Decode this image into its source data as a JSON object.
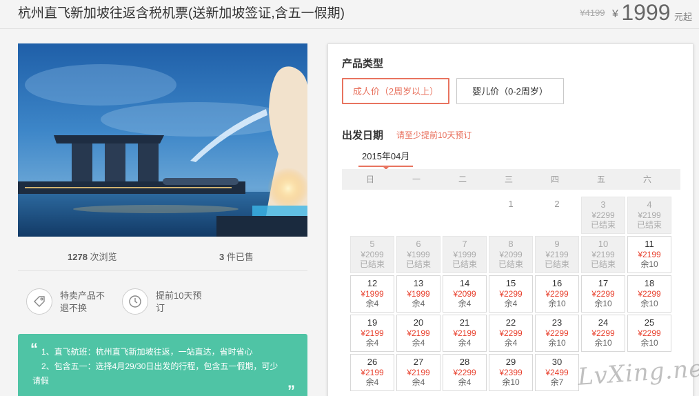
{
  "header": {
    "title": "杭州直飞新加坡往返含税机票(送新加坡签证,含五一假期)",
    "old_price": "¥4199",
    "currency": "¥",
    "price": "1999",
    "price_suffix": "元起"
  },
  "stats": {
    "views_count": "1278",
    "views_label": "次浏览",
    "sold_count": "3",
    "sold_label": "件已售"
  },
  "features": [
    {
      "icon": "tag-icon",
      "text": "特卖产品不退不换"
    },
    {
      "icon": "clock-icon",
      "text": "提前10天预订"
    }
  ],
  "notes": {
    "open_quote": "“",
    "close_quote": "”",
    "line1": "1、直飞航班：杭州直飞新加坡往返，一站直达，省时省心",
    "line2": "2、包含五一：选择4月29/30日出发的行程，包含五一假期，可少",
    "line3": "请假"
  },
  "panel": {
    "product_type_title": "产品类型",
    "adult_label": "成人价（2周岁以上）",
    "infant_label": "婴儿价（0-2周岁）",
    "departure_title": "出发日期",
    "departure_hint": "请至少提前10天预订",
    "month": "2015年04月",
    "weekdays": [
      "日",
      "一",
      "二",
      "三",
      "四",
      "五",
      "六"
    ]
  },
  "calendar": {
    "ended_label": "已结束",
    "days": [
      {
        "day": "1",
        "col": 3,
        "row": 0,
        "state": "plain"
      },
      {
        "day": "2",
        "col": 4,
        "row": 0,
        "state": "plain"
      },
      {
        "day": "3",
        "col": 5,
        "row": 0,
        "state": "ended",
        "price": "¥2299"
      },
      {
        "day": "4",
        "col": 6,
        "row": 0,
        "state": "ended",
        "price": "¥2199"
      },
      {
        "day": "5",
        "col": 0,
        "row": 1,
        "state": "ended",
        "price": "¥2099"
      },
      {
        "day": "6",
        "col": 1,
        "row": 1,
        "state": "ended",
        "price": "¥1999"
      },
      {
        "day": "7",
        "col": 2,
        "row": 1,
        "state": "ended",
        "price": "¥1999"
      },
      {
        "day": "8",
        "col": 3,
        "row": 1,
        "state": "ended",
        "price": "¥2099"
      },
      {
        "day": "9",
        "col": 4,
        "row": 1,
        "state": "ended",
        "price": "¥2199"
      },
      {
        "day": "10",
        "col": 5,
        "row": 1,
        "state": "ended",
        "price": "¥2199"
      },
      {
        "day": "11",
        "col": 6,
        "row": 1,
        "state": "open",
        "price": "¥2199",
        "stock": "余10"
      },
      {
        "day": "12",
        "col": 0,
        "row": 2,
        "state": "open",
        "price": "¥1999",
        "stock": "余4"
      },
      {
        "day": "13",
        "col": 1,
        "row": 2,
        "state": "open",
        "price": "¥1999",
        "stock": "余4"
      },
      {
        "day": "14",
        "col": 2,
        "row": 2,
        "state": "open",
        "price": "¥2099",
        "stock": "余4"
      },
      {
        "day": "15",
        "col": 3,
        "row": 2,
        "state": "open",
        "price": "¥2299",
        "stock": "余4"
      },
      {
        "day": "16",
        "col": 4,
        "row": 2,
        "state": "open",
        "price": "¥2299",
        "stock": "余10"
      },
      {
        "day": "17",
        "col": 5,
        "row": 2,
        "state": "open",
        "price": "¥2299",
        "stock": "余10"
      },
      {
        "day": "18",
        "col": 6,
        "row": 2,
        "state": "open",
        "price": "¥2299",
        "stock": "余10"
      },
      {
        "day": "19",
        "col": 0,
        "row": 3,
        "state": "open",
        "price": "¥2199",
        "stock": "余4"
      },
      {
        "day": "20",
        "col": 1,
        "row": 3,
        "state": "open",
        "price": "¥2199",
        "stock": "余4"
      },
      {
        "day": "21",
        "col": 2,
        "row": 3,
        "state": "open",
        "price": "¥2199",
        "stock": "余4"
      },
      {
        "day": "22",
        "col": 3,
        "row": 3,
        "state": "open",
        "price": "¥2299",
        "stock": "余4"
      },
      {
        "day": "23",
        "col": 4,
        "row": 3,
        "state": "open",
        "price": "¥2299",
        "stock": "余10"
      },
      {
        "day": "24",
        "col": 5,
        "row": 3,
        "state": "open",
        "price": "¥2299",
        "stock": "余10"
      },
      {
        "day": "25",
        "col": 6,
        "row": 3,
        "state": "open",
        "price": "¥2299",
        "stock": "余10"
      },
      {
        "day": "26",
        "col": 0,
        "row": 4,
        "state": "open",
        "price": "¥2199",
        "stock": "余4"
      },
      {
        "day": "27",
        "col": 1,
        "row": 4,
        "state": "open",
        "price": "¥2199",
        "stock": "余4"
      },
      {
        "day": "28",
        "col": 2,
        "row": 4,
        "state": "open",
        "price": "¥2299",
        "stock": "余4"
      },
      {
        "day": "29",
        "col": 3,
        "row": 4,
        "state": "open",
        "price": "¥2399",
        "stock": "余10"
      },
      {
        "day": "30",
        "col": 4,
        "row": 4,
        "state": "open",
        "price": "¥2499",
        "stock": "余7"
      }
    ]
  },
  "watermark": "LvXing.net",
  "colors": {
    "accent": "#e8735f",
    "price_red": "#e8412e",
    "notes_bg": "#4fc4a5",
    "ended_bg": "#f0f0f0"
  }
}
